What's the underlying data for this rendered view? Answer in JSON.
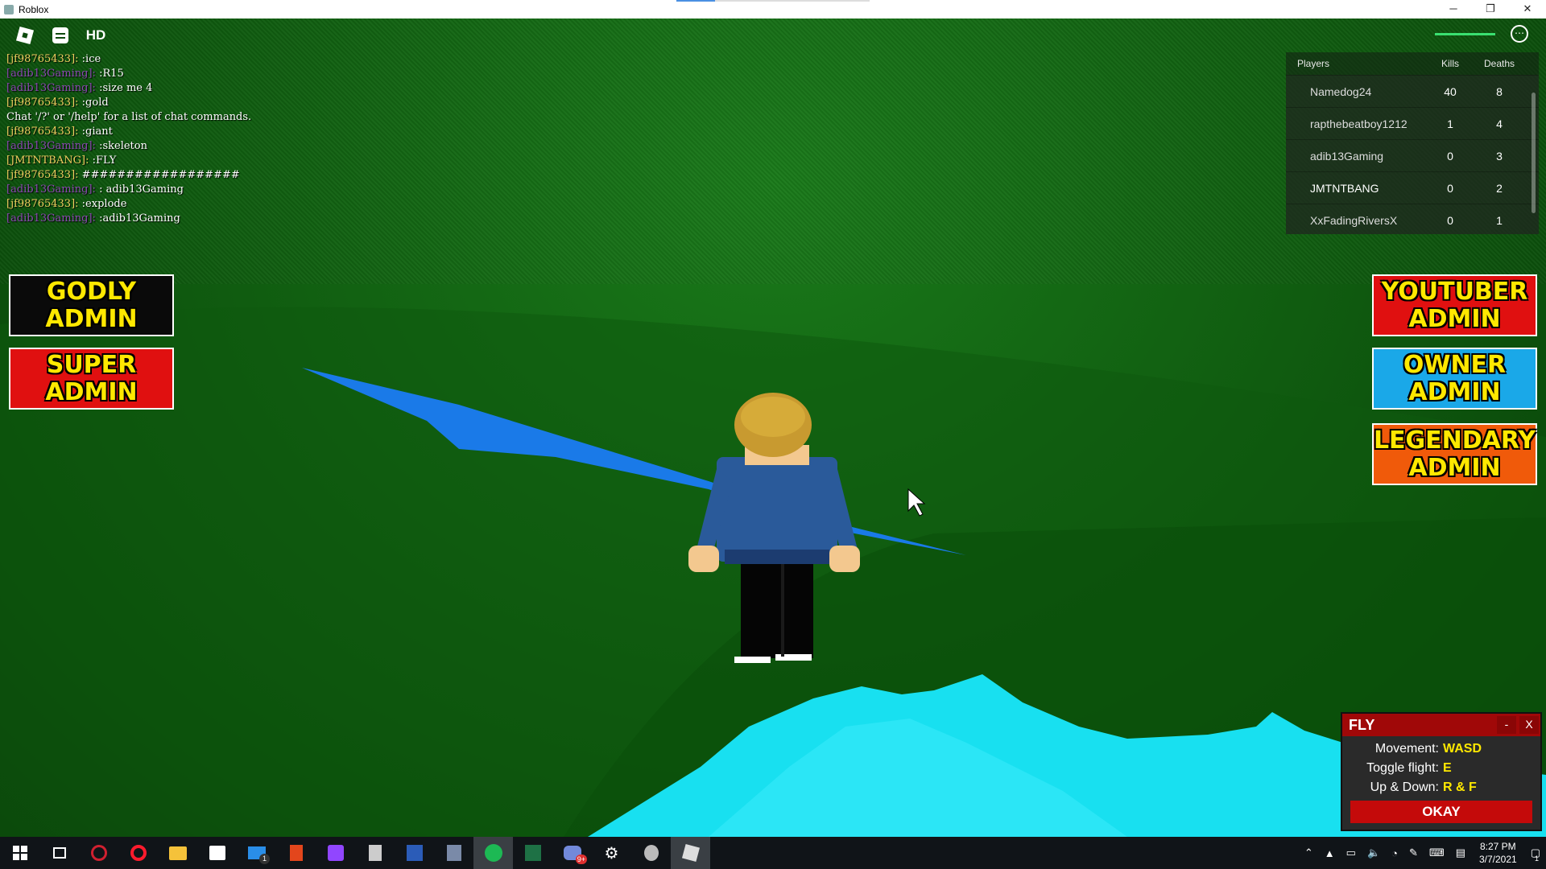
{
  "window": {
    "title": "Roblox",
    "controls": {
      "minimize": "─",
      "restore": "❐",
      "close": "✕"
    }
  },
  "topbar": {
    "menu_icon": "roblox-logo-icon",
    "chat_icon": "chat-icon",
    "hd_label": "HD",
    "more_icon": "⋯"
  },
  "chat": [
    {
      "name": "[jf98765433]:",
      "color": "yellow",
      "text": " :ice"
    },
    {
      "name": "[adib13Gaming]:",
      "color": "purple",
      "text": " :R15"
    },
    {
      "name": "[adib13Gaming]:",
      "color": "purple",
      "text": " :size me 4"
    },
    {
      "name": "[jf98765433]:",
      "color": "yellow",
      "text": " :gold"
    },
    {
      "name": "",
      "color": "white",
      "text": "Chat '/?' or '/help' for a list of chat commands."
    },
    {
      "name": "[jf98765433]:",
      "color": "yellow",
      "text": " :giant"
    },
    {
      "name": "[adib13Gaming]:",
      "color": "purple",
      "text": " :skeleton"
    },
    {
      "name": "[JMTNTBANG]:",
      "color": "yellow",
      "text": " :FLY"
    },
    {
      "name": "[jf98765433]:",
      "color": "yellow",
      "text": " ##################"
    },
    {
      "name": "[adib13Gaming]:",
      "color": "purple",
      "text": " : adib13Gaming"
    },
    {
      "name": "[jf98765433]:",
      "color": "yellow",
      "text": " :explode"
    },
    {
      "name": "[adib13Gaming]:",
      "color": "purple",
      "text": " :adib13Gaming"
    }
  ],
  "leaderboard": {
    "headers": {
      "players": "Players",
      "kills": "Kills",
      "deaths": "Deaths"
    },
    "rows": [
      {
        "name": "Namedog24",
        "kills": "40",
        "deaths": "8"
      },
      {
        "name": "rapthebeatboy1212",
        "kills": "1",
        "deaths": "4"
      },
      {
        "name": "adib13Gaming",
        "kills": "0",
        "deaths": "3"
      },
      {
        "name": "JMTNTBANG",
        "kills": "0",
        "deaths": "2"
      },
      {
        "name": "XxFadingRiversX",
        "kills": "0",
        "deaths": "1"
      }
    ]
  },
  "admin_buttons": {
    "godly": {
      "line1": "GODLY",
      "line2": "ADMIN",
      "bg": "#0a0a0a"
    },
    "super": {
      "line1": "SUPER",
      "line2": "ADMIN",
      "bg": "#e01010"
    },
    "youtuber": {
      "line1": "YOUTUBER",
      "line2": "ADMIN",
      "bg": "#e01010"
    },
    "owner": {
      "line1": "OWNER",
      "line2": "ADMIN",
      "bg": "#1aa8e8"
    },
    "legendary": {
      "line1": "LEGENDARY",
      "line2": "ADMIN",
      "bg": "#f05a0a"
    }
  },
  "fly_panel": {
    "title": "FLY",
    "minimize": "-",
    "close": "X",
    "rows": [
      {
        "label": "Movement:",
        "value": "WASD"
      },
      {
        "label": "Toggle flight:",
        "value": "E"
      },
      {
        "label": "Up & Down:",
        "value": "R & F"
      }
    ],
    "okay": "OKAY"
  },
  "taskbar": {
    "icons": [
      "windows-start-icon",
      "task-view-icon",
      "opera-gx-icon",
      "opera-icon",
      "file-explorer-icon",
      "store-icon",
      "mail-icon",
      "office-icon",
      "twitch-icon",
      "calculator-icon",
      "word-icon",
      "snipping-icon",
      "spotify-icon",
      "excel-icon",
      "discord-icon",
      "settings-icon",
      "roblox-player-icon",
      "roblox-icon"
    ],
    "mail_badge": "1",
    "discord_badge": "9+",
    "clock_time": "8:27 PM",
    "clock_date": "3/7/2021",
    "notification_badge": "1"
  }
}
